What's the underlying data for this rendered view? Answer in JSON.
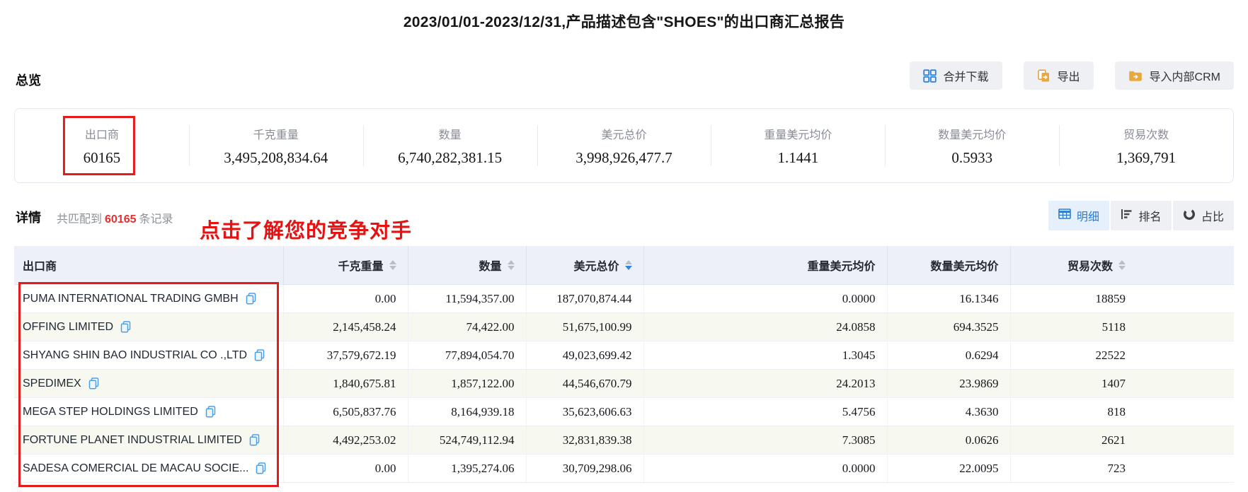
{
  "title": "2023/01/01-2023/12/31,产品描述包含\"SHOES\"的出口商汇总报告",
  "overview": {
    "heading": "总览",
    "buttons": {
      "merge_download": "合并下载",
      "export": "导出",
      "import_crm": "导入内部CRM"
    },
    "stats": [
      {
        "label": "出口商",
        "value": "60165",
        "highlighted": true
      },
      {
        "label": "千克重量",
        "value": "3,495,208,834.64"
      },
      {
        "label": "数量",
        "value": "6,740,282,381.15"
      },
      {
        "label": "美元总价",
        "value": "3,998,926,477.7"
      },
      {
        "label": "重量美元均价",
        "value": "1.1441"
      },
      {
        "label": "数量美元均价",
        "value": "0.5933"
      },
      {
        "label": "贸易次数",
        "value": "1,369,791"
      }
    ]
  },
  "details": {
    "heading": "详情",
    "match_prefix": "共匹配到",
    "match_count": "60165",
    "match_suffix": "条记录",
    "annotation": "点击了解您的竞争对手",
    "view_buttons": [
      {
        "label": "明细",
        "icon": "table-icon",
        "active": true
      },
      {
        "label": "排名",
        "icon": "ranking-icon",
        "active": false
      },
      {
        "label": "占比",
        "icon": "pie-icon",
        "active": false
      }
    ]
  },
  "table": {
    "columns": [
      {
        "label": "出口商",
        "sortable": false
      },
      {
        "label": "千克重量",
        "sortable": true,
        "sort": "none"
      },
      {
        "label": "数量",
        "sortable": true,
        "sort": "none"
      },
      {
        "label": "美元总价",
        "sortable": true,
        "sort": "desc"
      },
      {
        "label": "重量美元均价",
        "sortable": false
      },
      {
        "label": "数量美元均价",
        "sortable": false
      },
      {
        "label": "贸易次数",
        "sortable": true,
        "sort": "none"
      }
    ],
    "rows": [
      {
        "exporter": "PUMA INTERNATIONAL TRADING GMBH",
        "kg": "0.00",
        "qty": "11,594,357.00",
        "usd": "187,070,874.44",
        "kg_price": "0.0000",
        "qty_price": "16.1346",
        "trades": "18859"
      },
      {
        "exporter": "OFFING LIMITED",
        "kg": "2,145,458.24",
        "qty": "74,422.00",
        "usd": "51,675,100.99",
        "kg_price": "24.0858",
        "qty_price": "694.3525",
        "trades": "5118"
      },
      {
        "exporter": "SHYANG SHIN BAO INDUSTRIAL CO .,LTD",
        "kg": "37,579,672.19",
        "qty": "77,894,054.70",
        "usd": "49,023,699.42",
        "kg_price": "1.3045",
        "qty_price": "0.6294",
        "trades": "22522"
      },
      {
        "exporter": "SPEDIMEX",
        "kg": "1,840,675.81",
        "qty": "1,857,122.00",
        "usd": "44,546,670.79",
        "kg_price": "24.2013",
        "qty_price": "23.9869",
        "trades": "1407"
      },
      {
        "exporter": "MEGA STEP HOLDINGS LIMITED",
        "kg": "6,505,837.76",
        "qty": "8,164,939.18",
        "usd": "35,623,606.63",
        "kg_price": "5.4756",
        "qty_price": "4.3630",
        "trades": "818"
      },
      {
        "exporter": "FORTUNE PLANET INDUSTRIAL LIMITED",
        "kg": "4,492,253.02",
        "qty": "524,749,112.94",
        "usd": "32,831,839.38",
        "kg_price": "7.3085",
        "qty_price": "0.0626",
        "trades": "2621"
      },
      {
        "exporter": "SADESA COMERCIAL DE MACAU SOCIE...",
        "kg": "0.00",
        "qty": "1,395,274.06",
        "usd": "30,709,298.06",
        "kg_price": "0.0000",
        "qty_price": "22.0095",
        "trades": "723"
      }
    ]
  },
  "colors": {
    "accent_blue": "#2e82e0",
    "active_view_bg": "#e5f0fc",
    "annotation_red": "#e51a1a",
    "orange_icon": "#e9a83e",
    "header_bg": "#edf0f7",
    "zebra_row": "#f7f9f0"
  }
}
